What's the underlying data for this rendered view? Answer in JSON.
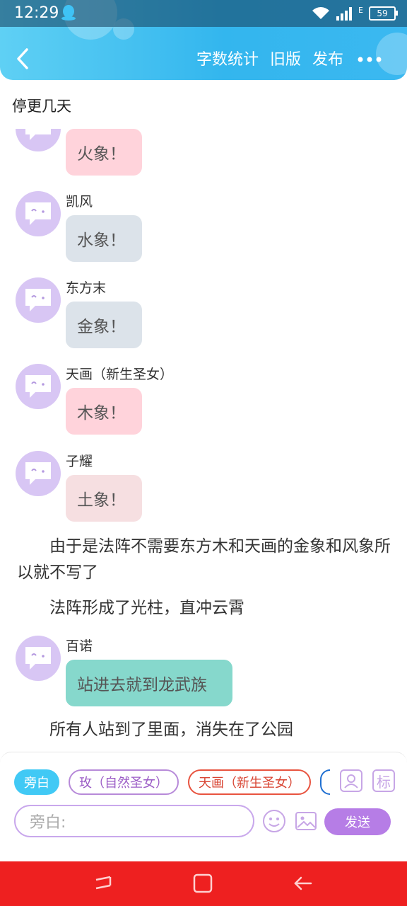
{
  "status": {
    "time": "12:29",
    "network": "E",
    "battery": "59"
  },
  "header": {
    "actions": [
      "字数统计",
      "旧版",
      "发布"
    ]
  },
  "title": "停更几天",
  "messages": [
    {
      "speaker": "",
      "text": "火象！",
      "color": "#ffd3db"
    },
    {
      "speaker": "凯风",
      "text": "水象！",
      "color": "#dce3ea"
    },
    {
      "speaker": "东方末",
      "text": "金象！",
      "color": "#dce3ea"
    },
    {
      "speaker": "天画（新生圣女）",
      "text": "木象！",
      "color": "#ffd3db"
    },
    {
      "speaker": "子耀",
      "text": "土象！",
      "color": "#f6dfe1"
    }
  ],
  "narrations": [
    "由于是法阵不需要东方木和天画的金象和风象所以就不写了",
    "法阵形成了光柱，直冲云霄"
  ],
  "message_baino": {
    "speaker": "百诺",
    "text": "站进去就到龙武族",
    "color": "#86d8cc"
  },
  "narration_last": "所有人站到了里面，消失在了公园",
  "composer": {
    "chips": [
      "旁白",
      "玫（自然圣女）",
      "天画（新生圣女）"
    ],
    "label_button": "标",
    "placeholder": "旁白:",
    "send": "发送"
  },
  "colors": {
    "accent": "#41c9f5",
    "send": "#b67de6",
    "navbar": "#ee2020"
  }
}
